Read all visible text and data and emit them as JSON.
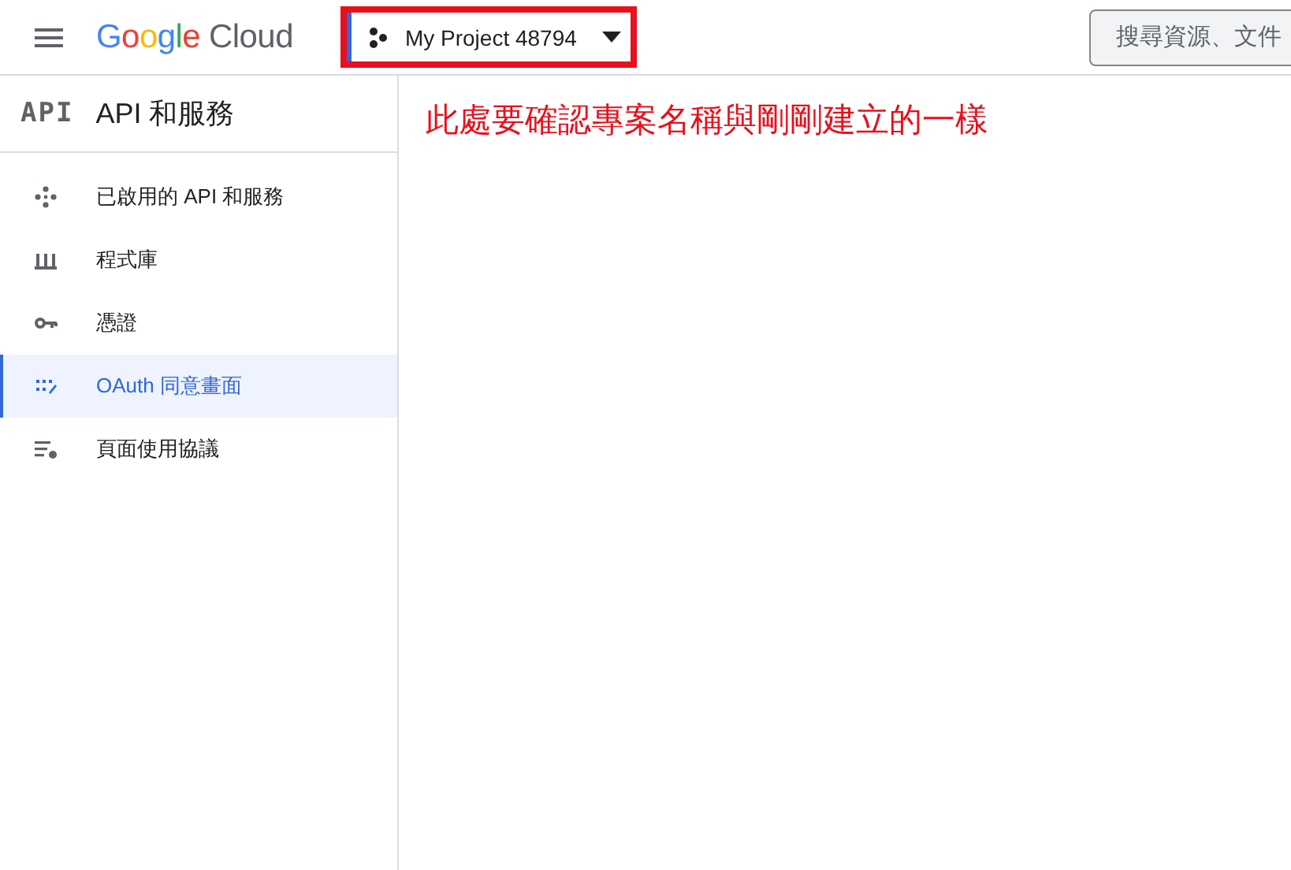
{
  "header": {
    "logo": "Google Cloud",
    "project": "My Project 48794",
    "search": {
      "placeholder": "搜尋資源、文件"
    }
  },
  "sidebar": {
    "badge": "API",
    "title": "API 和服務",
    "items": [
      {
        "label": "已啟用的 API 和服務",
        "kind": "hub",
        "selected": false
      },
      {
        "label": "程式庫",
        "kind": "library",
        "selected": false
      },
      {
        "label": "憑證",
        "kind": "key",
        "selected": false
      },
      {
        "label": "OAuth 同意畫面",
        "kind": "consent",
        "selected": true
      },
      {
        "label": "頁面使用協議",
        "kind": "settings",
        "selected": false
      }
    ]
  },
  "annotation": {
    "text": "此處要確認專案名稱與剛剛建立的一樣"
  }
}
